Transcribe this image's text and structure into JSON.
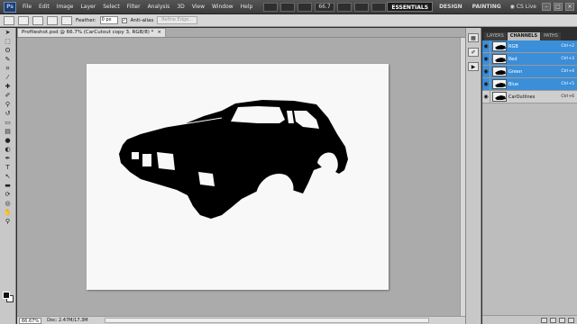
{
  "menubar": {
    "logo": "Ps",
    "items": [
      "File",
      "Edit",
      "Image",
      "Layer",
      "Select",
      "Filter",
      "Analysis",
      "3D",
      "View",
      "Window",
      "Help"
    ],
    "zoom": "66.7",
    "workspaces": [
      "ESSENTIALS",
      "DESIGN",
      "PAINTING"
    ],
    "active_workspace": "ESSENTIALS",
    "cs_live": "CS Live"
  },
  "options": {
    "feather_label": "Feather:",
    "feather_value": "0 px",
    "antialias_label": "Anti-alias",
    "antialias_checked": true,
    "refine_edge": "Refine Edge..."
  },
  "document": {
    "tab_title": "Profileshot.psd @ 66.7% (CarCutout copy 3, RGB/8) *",
    "tab_close": "×"
  },
  "status": {
    "zoom": "66.67%",
    "doc_size": "Doc: 2.47M/17.3M"
  },
  "channels_panel": {
    "tabs": [
      "LAYERS",
      "CHANNELS",
      "PATHS"
    ],
    "active_tab": "CHANNELS",
    "channels": [
      {
        "name": "RGB",
        "shortcut": "Ctrl+2",
        "selected": true,
        "visible": true
      },
      {
        "name": "Red",
        "shortcut": "Ctrl+3",
        "selected": true,
        "visible": true
      },
      {
        "name": "Green",
        "shortcut": "Ctrl+4",
        "selected": true,
        "visible": true
      },
      {
        "name": "Blue",
        "shortcut": "Ctrl+5",
        "selected": true,
        "visible": true
      },
      {
        "name": "CarOutlines",
        "shortcut": "Ctrl+6",
        "selected": false,
        "visible": true
      }
    ]
  },
  "colors": {
    "selection_blue": "#3b8ed8",
    "canvas_bg": "#f8f8f8",
    "car_silhouette": "#000000"
  }
}
